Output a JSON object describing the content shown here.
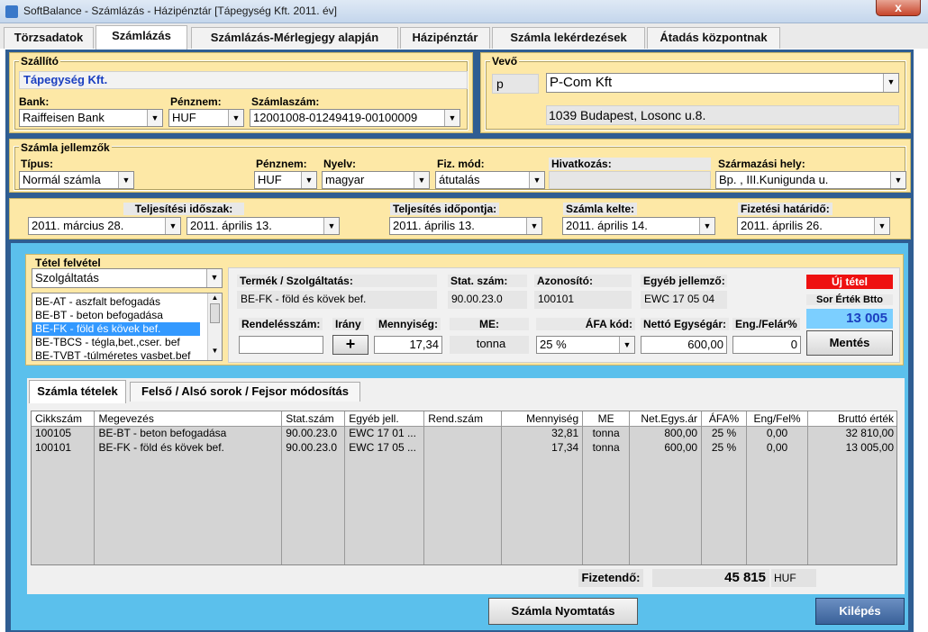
{
  "window": {
    "title": "SoftBalance - Számlázás - Házipénztár  [Tápegység Kft.  2011. év]",
    "close": "x"
  },
  "tabs": [
    "Törzsadatok",
    "Számlázás",
    "Számlázás-Mérlegjegy alapján",
    "Házipénztár",
    "Számla lekérdezések",
    "Átadás központnak"
  ],
  "szallito": {
    "title": "Szállító",
    "name": "Tápegység Kft.",
    "bank_label": "Bank:",
    "bank": "Raiffeisen Bank",
    "penznem_label": "Pénznem:",
    "penznem": "HUF",
    "szamlaszam_label": "Számlaszám:",
    "szamlaszam": "12001008-01249419-00100009"
  },
  "vevo": {
    "title": "Vevő",
    "code": "p",
    "name": "P-Com Kft",
    "address": "1039  Budapest,   Losonc u.8."
  },
  "jellemzok": {
    "title": "Számla jellemzők",
    "tipus_label": "Típus:",
    "tipus": "Normál számla",
    "penznem_label": "Pénznem:",
    "penznem": "HUF",
    "nyelv_label": "Nyelv:",
    "nyelv": "magyar",
    "fiz_label": "Fiz. mód:",
    "fiz": "átutalás",
    "hiv_label": "Hivatkozás:",
    "hiv": "",
    "szarm_label": "Származási hely:",
    "szarm": "Bp. , III.Kunigunda u."
  },
  "dates": {
    "telj_idoszak_label": "Teljesítési időszak:",
    "telj_from": "2011.    március   28.",
    "telj_to": "2011.    április    13.",
    "telj_idopont_label": "Teljesítés időpontja:",
    "telj_idopont": "2011.    április    13.",
    "kelte_label": "Számla kelte:",
    "kelte": "2011.    április    14.",
    "hatarido_label": "Fizetési határidő:",
    "hatarido": "2011.    április    26."
  },
  "tetel": {
    "title": "Tétel felvétel",
    "category": "Szolgáltatás",
    "list": [
      "BE-AT - aszfalt befogadás",
      "BE-BT - beton befogadása",
      "BE-FK - föld és kövek bef.",
      "BE-TBCS - tégla,bet.,cser. bef",
      "BE-TVBT -túlméretes vasbet.bef"
    ],
    "termek_label": "Termék / Szolgáltatás:",
    "termek": "BE-FK - föld és kövek bef.",
    "stat_label": "Stat. szám:",
    "stat": "90.00.23.0",
    "azon_label": "Azonosító:",
    "azon": "100101",
    "egyeb_label": "Egyéb jellemző:",
    "egyeb": "EWC 17 05 04",
    "uj_tetel": "Új tétel",
    "sor_label": "Sor Érték Btto",
    "sor_ertek": "13 005",
    "rend_label": "Rendelésszám:",
    "rend": "",
    "irany_label": "Irány",
    "irany": "+",
    "menny_label": "Mennyiség:",
    "menny": "17,34",
    "me_label": "ME:",
    "me": "tonna",
    "afa_label": "ÁFA kód:",
    "afa": "25 %",
    "netto_label": "Nettó Egységár:",
    "netto": "600,00",
    "eng_label": "Eng./Felár%",
    "eng": "0",
    "mentes": "Mentés"
  },
  "subtabs": [
    "Számla tételek",
    "Felső / Alsó sorok / Fejsor módosítás"
  ],
  "table": {
    "headers": [
      "Cikkszám",
      "Megevezés",
      "Stat.szám",
      "Egyéb jell.",
      "Rend.szám",
      "Mennyiség",
      "ME",
      "Net.Egys.ár",
      "ÁFA%",
      "Eng/Fel%",
      "Bruttó érték"
    ],
    "rows": [
      [
        "100105",
        "BE-BT - beton befogadása",
        "90.00.23.0",
        "EWC 17 01 ...",
        "",
        "32,81",
        "tonna",
        "800,00",
        "25 %",
        "0,00",
        "32 810,00"
      ],
      [
        "100101",
        "BE-FK - föld és kövek bef.",
        "90.00.23.0",
        "EWC 17 05 ...",
        "",
        "17,34",
        "tonna",
        "600,00",
        "25 %",
        "0,00",
        "13 005,00"
      ]
    ]
  },
  "footer": {
    "fizetendo_label": "Fizetendő:",
    "fizetendo": "45 815",
    "currency": "HUF",
    "print": "Számla Nyomtatás",
    "exit": "Kilépés"
  }
}
